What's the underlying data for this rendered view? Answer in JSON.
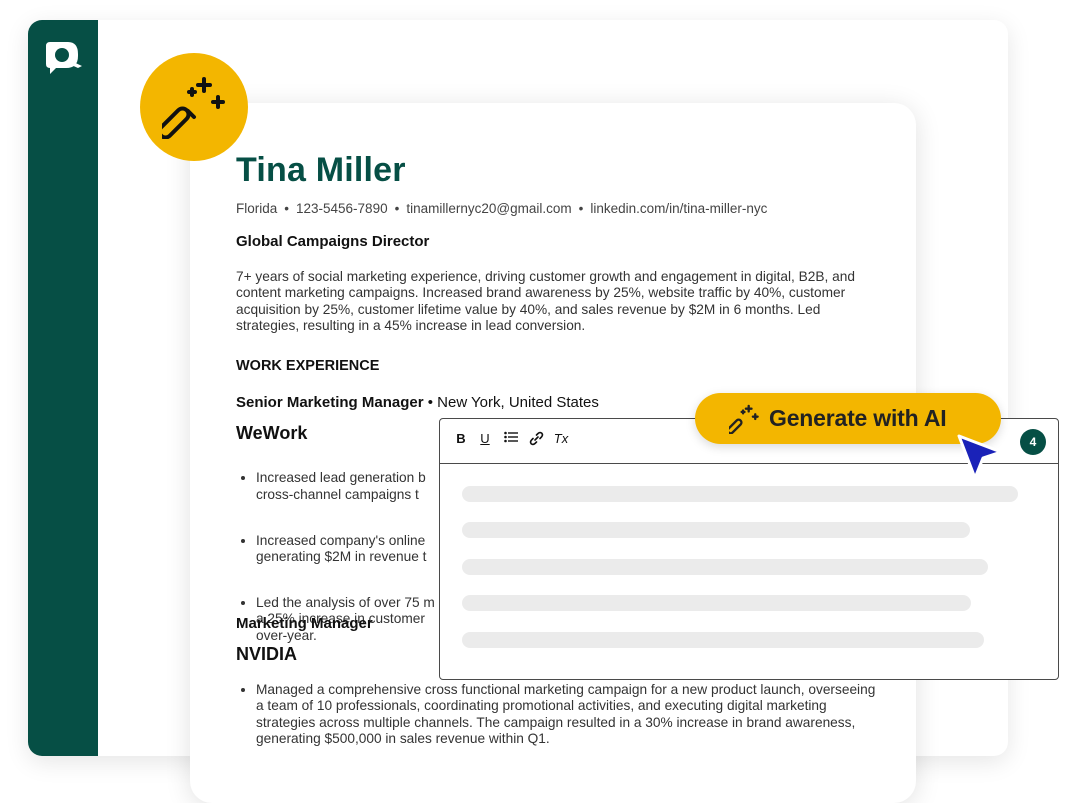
{
  "resume": {
    "name": "Tina Miller",
    "contact": {
      "location": "Florida",
      "phone": "123-5456-7890",
      "email": "tinamillernyc20@gmail.com",
      "linkedin": "linkedin.com/in/tina-miller-nyc",
      "separator": "•"
    },
    "title": "Global Campaigns Director",
    "summary": "7+ years of social marketing experience, driving customer growth and engagement in digital, B2B, and content marketing campaigns. Increased brand awareness by 25%, website traffic by 40%, customer acquisition by 25%, customer lifetime value by 40%, and sales revenue by $2M in 6 months. Led strategies, resulting in a 45% increase in lead conversion.",
    "section_heading": "WORK EXPERIENCE",
    "job1": {
      "role": "Senior Marketing Manager",
      "sep": " • ",
      "location": "New York, United States",
      "company": "WeWork",
      "bullets": [
        "Increased lead generation b\ncross-channel campaigns t",
        "Increased company's online\ngenerating $2M in revenue t",
        "Led the analysis of over 75 m\na 25% increase in customer\nover-year."
      ]
    },
    "job2": {
      "role": "Marketing Manager",
      "company": "NVIDIA",
      "bullets": [
        "Managed a comprehensive cross functional marketing campaign for a new product launch, overseeing a team of 10 professionals, coordinating promotional activities, and executing digital marketing strategies across multiple channels. The campaign resulted in a 30% increase in brand awareness, generating $500,000 in sales revenue within Q1."
      ]
    }
  },
  "editor": {
    "toolbar": {
      "bold": "B",
      "underline": "U",
      "list_icon": "list-icon",
      "link_icon": "link-icon",
      "clear_format": "Tx"
    },
    "badge_count": "4"
  },
  "ai_button": {
    "label": "Generate with AI"
  },
  "colors": {
    "brand_green": "#064f45",
    "accent_yellow": "#f3b600",
    "cursor_blue": "#1a22b8"
  }
}
